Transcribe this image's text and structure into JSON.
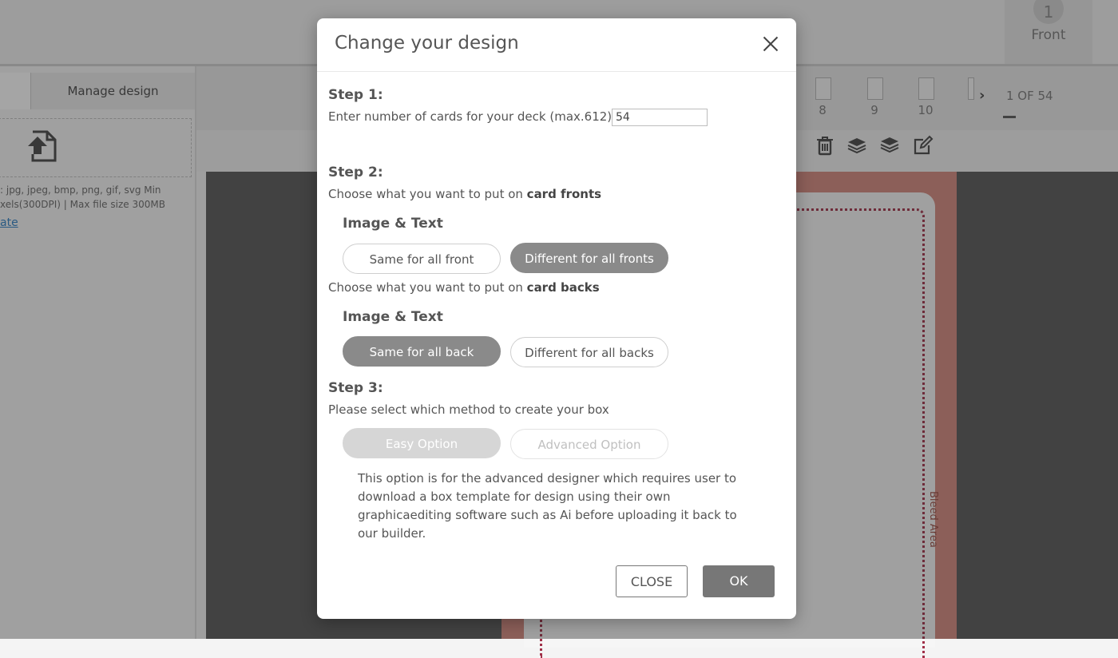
{
  "header": {
    "page_number": "1",
    "page_label": "Front"
  },
  "left_panel": {
    "tab_manage": "Manage design",
    "upload_hint_1": ": jpg, jpeg, bmp, png, gif, svg Min",
    "upload_hint_2": "xels(300DPI) | Max file size 300MB",
    "upload_link": "ate"
  },
  "pagebar": {
    "thumbs": [
      "8",
      "9",
      "10"
    ],
    "next": "›",
    "count": "1 OF 54"
  },
  "canvas": {
    "bleed_label": "Bleed Area"
  },
  "modal": {
    "title": "Change your design",
    "step1": {
      "heading": "Step 1:",
      "label": "Enter number of cards for your deck (max.612)",
      "value": "54"
    },
    "step2": {
      "heading": "Step 2:",
      "fronts_prefix": "Choose what you want to put on ",
      "fronts_bold": "card fronts",
      "fronts_sub": "Image & Text",
      "front_same": "Same for all front",
      "front_diff": "Different for all fronts",
      "backs_prefix": "Choose what you want to put on ",
      "backs_bold": "card backs",
      "backs_sub": "Image & Text",
      "back_same": "Same for all back",
      "back_diff": "Different for all backs"
    },
    "step3": {
      "heading": "Step 3:",
      "label": "Please select which method to create your box",
      "easy": "Easy Option",
      "advanced": "Advanced Option",
      "description": "This option is for the advanced designer which requires user to download a box template for design using their own graphicaediting software such as Ai before uploading it back to our builder."
    },
    "close_button": "CLOSE",
    "ok_button": "OK"
  },
  "colors": {
    "selected_pill": "#8a8a8a",
    "bleed": "#d4877c",
    "safe_line": "#a03048"
  }
}
